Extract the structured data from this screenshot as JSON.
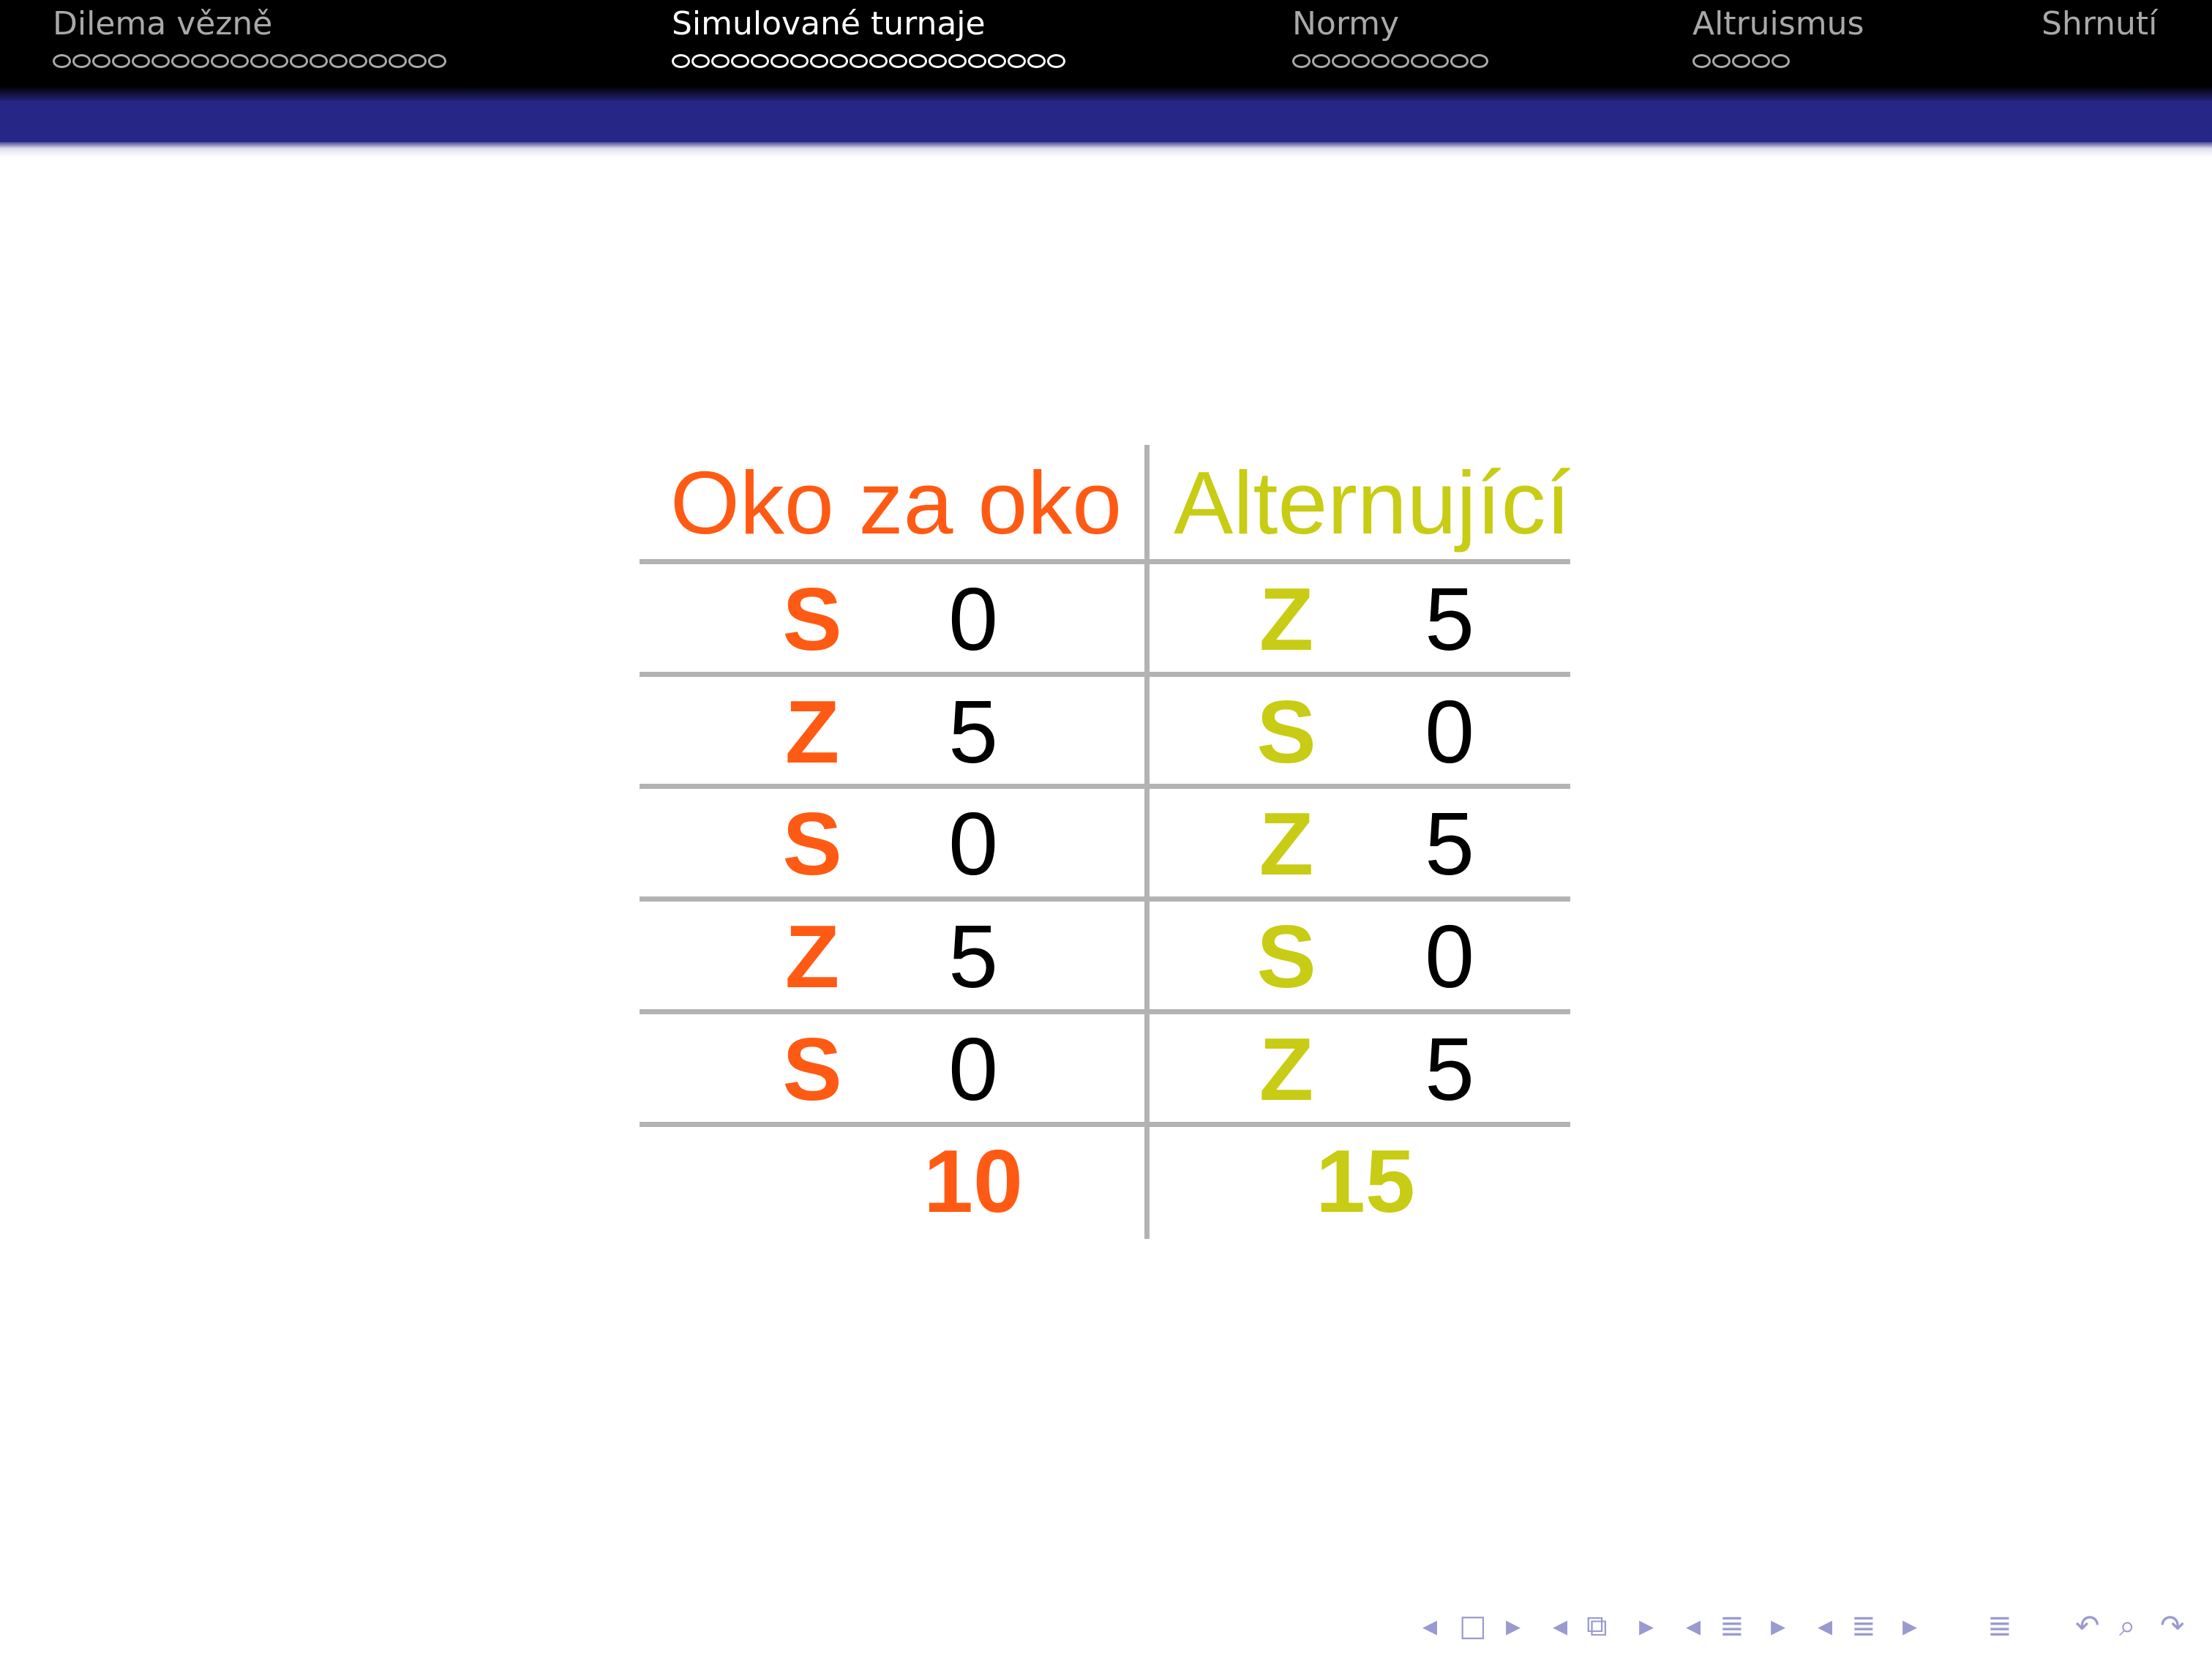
{
  "header": {
    "sections": [
      {
        "title": "Dilema vězně",
        "dots": 20,
        "current": false
      },
      {
        "title": "Simulované turnaje",
        "dots": 20,
        "current": true
      },
      {
        "title": "Normy",
        "dots": 10,
        "current": false
      },
      {
        "title": "Altruismus",
        "dots": 5,
        "current": false
      },
      {
        "title": "Shrnutí",
        "dots": 0,
        "current": false
      }
    ]
  },
  "table": {
    "left": {
      "name": "Oko za oko",
      "color": "#ff5a14",
      "rows": [
        {
          "move": "S",
          "points": "0"
        },
        {
          "move": "Z",
          "points": "5"
        },
        {
          "move": "S",
          "points": "0"
        },
        {
          "move": "Z",
          "points": "5"
        },
        {
          "move": "S",
          "points": "0"
        }
      ],
      "total": "10"
    },
    "right": {
      "name": "Alternující",
      "color": "#c8cc14",
      "rows": [
        {
          "move": "Z",
          "points": "5"
        },
        {
          "move": "S",
          "points": "0"
        },
        {
          "move": "Z",
          "points": "5"
        },
        {
          "move": "S",
          "points": "0"
        },
        {
          "move": "Z",
          "points": "5"
        }
      ],
      "total": "15"
    }
  },
  "nav": {
    "icons": [
      "arrow-left-icon",
      "frame-icon",
      "arrow-right-icon",
      "arrow-left-icon",
      "subsection-icon",
      "arrow-right-icon",
      "arrow-left-icon",
      "section-icon",
      "arrow-right-icon",
      "arrow-left-icon",
      "section-icon",
      "arrow-right-icon",
      "align-icon",
      "undo-icon",
      "search-icon",
      "redo-icon"
    ],
    "color": "#9a9ad0"
  }
}
